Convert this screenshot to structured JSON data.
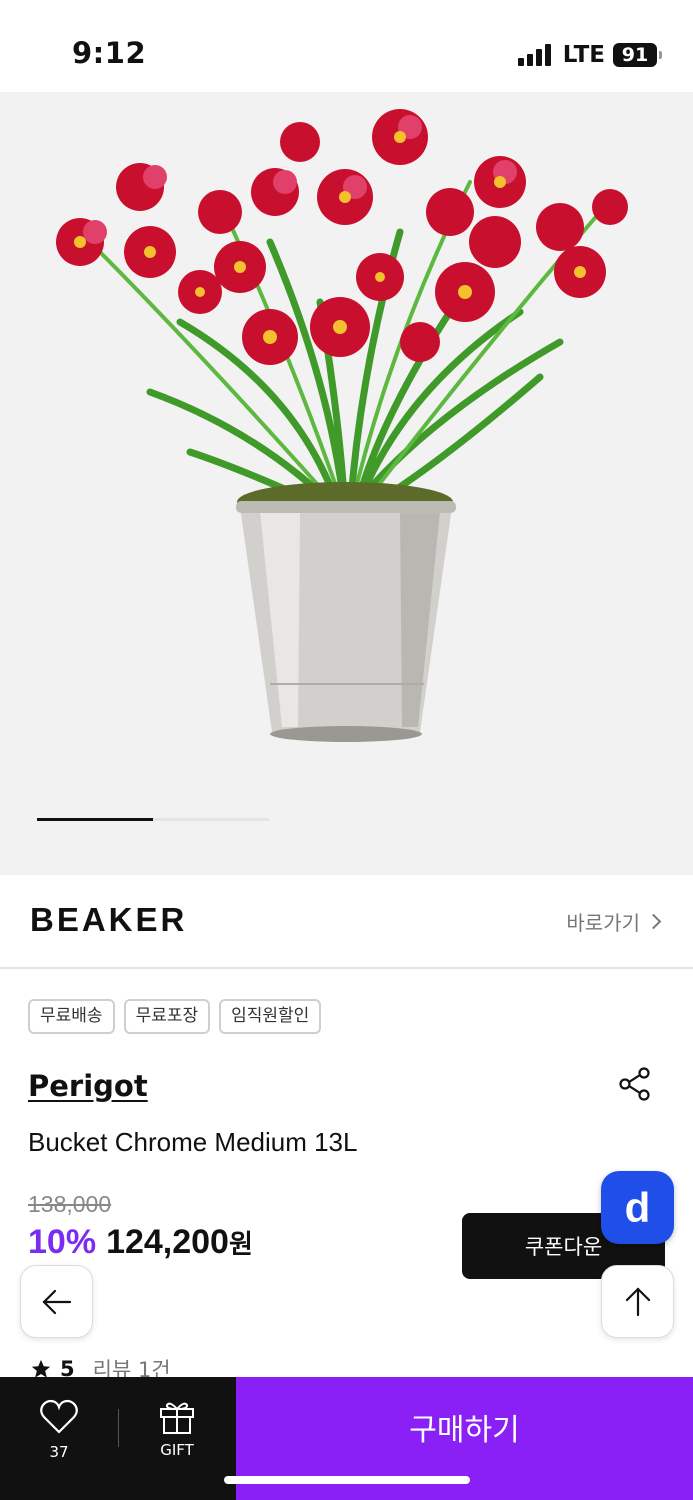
{
  "status_bar": {
    "time": "9:12",
    "network": "LTE",
    "battery": "91"
  },
  "gallery": {
    "current_index": 1,
    "total": 2,
    "image_alt": "red orchid plant in chrome bucket"
  },
  "brand_bar": {
    "logo": "BEAKER",
    "goto_label": "바로가기"
  },
  "tags": [
    "무료배송",
    "무료포장",
    "임직원할인"
  ],
  "product": {
    "brand": "Perigot",
    "name": "Bucket Chrome Medium 13L",
    "original_price": "138,000",
    "discount": "10%",
    "price": "124,200",
    "currency": "원",
    "coupon_label": "쿠폰다운",
    "badge_letter": "d"
  },
  "rating": {
    "score": "5",
    "reviews": "리뷰 1건"
  },
  "bottom_bar": {
    "like_count": "37",
    "gift_label": "GIFT",
    "buy_label": "구매하기"
  },
  "colors": {
    "accent": "#8a20f5",
    "discount": "#7a2cf0",
    "badge": "#1f4ee8",
    "dark": "#111111"
  },
  "icons": [
    "share-icon",
    "back-arrow-icon",
    "up-arrow-icon",
    "heart-icon",
    "gift-icon",
    "star-icon",
    "chevron-right-icon"
  ]
}
